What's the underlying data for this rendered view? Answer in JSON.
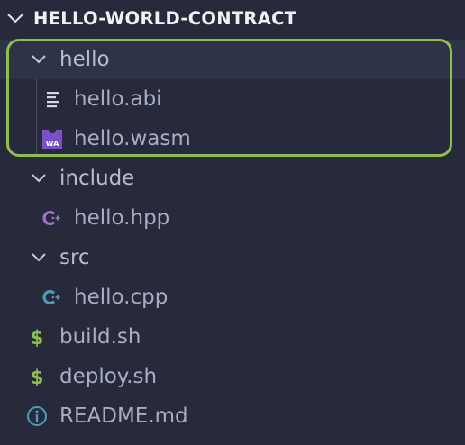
{
  "explorer": {
    "section_title": "HELLO-WORLD-CONTRACT",
    "highlight_color": "#8fbe4d",
    "background": "#272a3b",
    "items": [
      {
        "label": "hello",
        "kind": "folder",
        "expanded": true,
        "icon": "chevron-down-icon"
      },
      {
        "label": "hello.abi",
        "kind": "file",
        "icon": "lines-file-icon"
      },
      {
        "label": "hello.wasm",
        "kind": "file",
        "icon": "wasm-icon",
        "icon_text": "WA",
        "icon_color": "#7a4fc9"
      },
      {
        "label": "include",
        "kind": "folder",
        "expanded": true,
        "icon": "chevron-down-icon"
      },
      {
        "label": "hello.hpp",
        "kind": "file",
        "icon": "cpp-header-icon",
        "icon_color": "#a074c4"
      },
      {
        "label": "src",
        "kind": "folder",
        "expanded": true,
        "icon": "chevron-down-icon"
      },
      {
        "label": "hello.cpp",
        "kind": "file",
        "icon": "cpp-icon",
        "icon_color": "#519aba"
      },
      {
        "label": "build.sh",
        "kind": "file",
        "icon": "shell-dollar-icon",
        "icon_color": "#8dc149"
      },
      {
        "label": "deploy.sh",
        "kind": "file",
        "icon": "shell-dollar-icon",
        "icon_color": "#8dc149"
      },
      {
        "label": "README.md",
        "kind": "file",
        "icon": "info-icon",
        "icon_color": "#519aba"
      }
    ]
  }
}
